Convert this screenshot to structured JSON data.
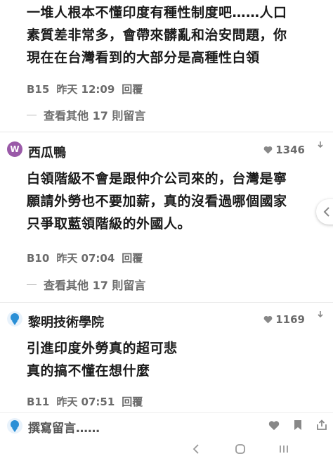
{
  "comments": [
    {
      "text_lines": [
        "一堆人根本不懂印度有種性制度吧……人口",
        "素質差非常多，會帶來髒亂和治安問題，你",
        "現在在台灣看到的大部分是高種性白領"
      ],
      "floor": "B15",
      "time": "昨天 12:09",
      "reply_label": "回覆",
      "more_replies": "查看其他 17 則留言"
    },
    {
      "author": "西瓜鴨",
      "avatar_letter": "W",
      "likes": "1346",
      "text_lines": [
        "白領階級不會是跟仲介公司來的，台灣是寧",
        "願請外勞也不要加薪，真的沒看過哪個國家",
        "只爭取藍領階級的外國人。"
      ],
      "floor": "B10",
      "time": "昨天 07:04",
      "reply_label": "回覆",
      "more_replies": "查看其他 17 則留言"
    },
    {
      "author": "黎明技術學院",
      "likes": "1169",
      "text_lines": [
        "引進印度外勞真的超可悲",
        "真的搞不懂在想什麼"
      ],
      "floor": "B11",
      "time": "昨天 07:51",
      "reply_label": "回覆"
    }
  ],
  "compose": {
    "placeholder": "撰寫留言……"
  },
  "colors": {
    "avatar_w": "#9a5aa8",
    "school_badge": "#2a8fd6",
    "meta_gray": "#6b6b6b"
  }
}
